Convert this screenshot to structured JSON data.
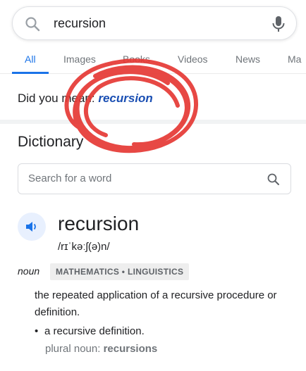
{
  "search": {
    "query": "recursion"
  },
  "tabs": [
    {
      "label": "All"
    },
    {
      "label": "Images"
    },
    {
      "label": "Books"
    },
    {
      "label": "Videos"
    },
    {
      "label": "News"
    },
    {
      "label": "Ma"
    }
  ],
  "did_you_mean": {
    "prefix": "Did you mean: ",
    "suggestion": "recursion"
  },
  "dictionary": {
    "title": "Dictionary",
    "search_placeholder": "Search for a word",
    "headword": "recursion",
    "phonetic": "/rɪˈkəːʃ(ə)n/",
    "part_of_speech": "noun",
    "domain_tag": "MATHEMATICS • LINGUISTICS",
    "definition": "the repeated application of a recursive procedure or definition.",
    "example": "a recursive definition.",
    "plural_label": "plural noun: ",
    "plural_value": "recursions"
  },
  "colors": {
    "accent": "#1a73e8",
    "suggestion": "#1a4fb3",
    "scribble": "#e53935"
  },
  "icons": [
    "search-icon",
    "mic-icon",
    "speaker-icon"
  ]
}
